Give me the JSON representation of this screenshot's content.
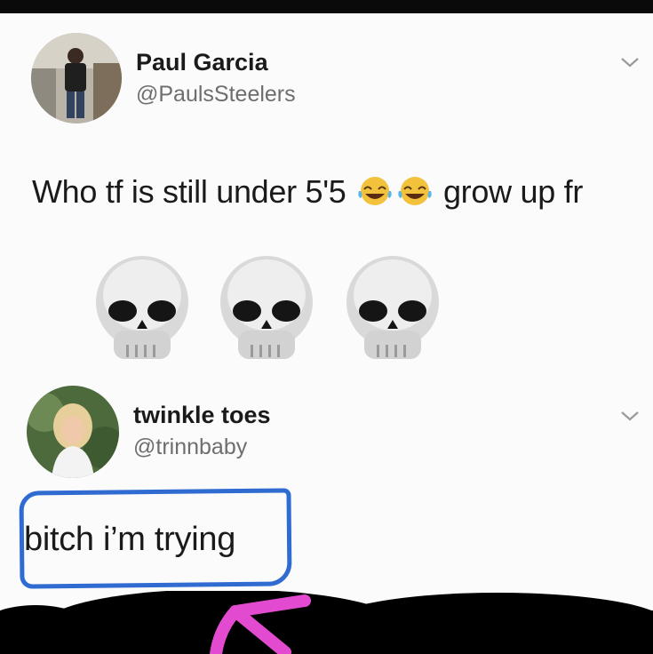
{
  "tweet": {
    "author_name": "Paul Garcia",
    "author_handle": "@PaulsSteelers",
    "text_part1": "Who tf is still under 5'5",
    "text_part2": "grow up fr",
    "emoji_inline": [
      "face-with-tears-of-joy-icon",
      "face-with-tears-of-joy-icon"
    ],
    "emoji_block": [
      "skull-icon",
      "skull-icon",
      "skull-icon"
    ]
  },
  "reply": {
    "author_name": "twinkle toes",
    "author_handle": "@trinnbaby",
    "text": "bitch i’m trying",
    "highlight_color": "#2f6bd0"
  },
  "annotations": {
    "arrow_color": "#e24bd0",
    "redaction_color": "#000000"
  }
}
